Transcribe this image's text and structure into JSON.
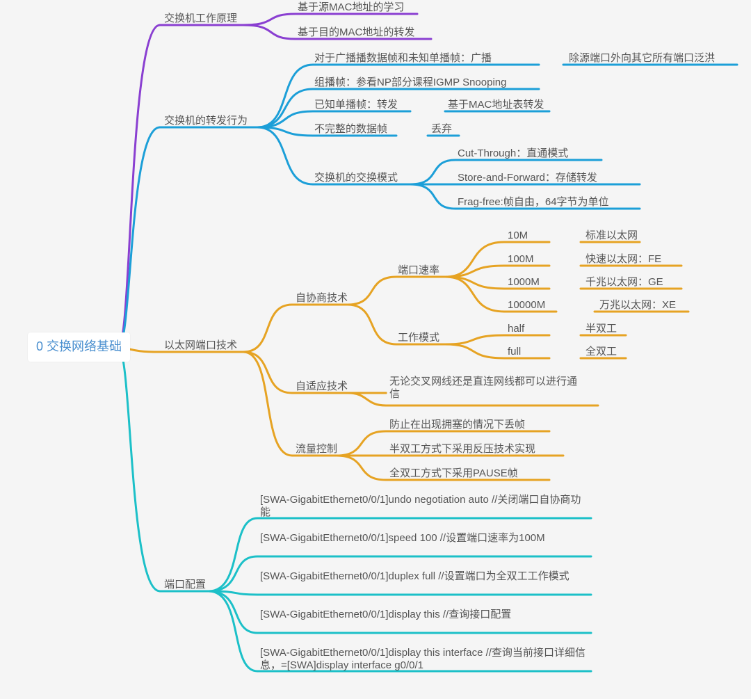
{
  "root": "0 交换网络基础",
  "b1": {
    "label": "交换机工作原理",
    "c1": "基于源MAC地址的学习",
    "c2": "基于目的MAC地址的转发"
  },
  "b2": {
    "label": "交换机的转发行为",
    "c1": "对于广播播数据帧和未知单播帧：广播",
    "c1a": "除源端口外向其它所有端口泛洪",
    "c2": "组播帧：参看NP部分课程IGMP Snooping",
    "c3": "已知单播帧：转发",
    "c3a": "基于MAC地址表转发",
    "c4": "不完整的数据帧",
    "c4a": "丢弃",
    "c5": {
      "label": "交换机的交换模式",
      "m1": "Cut-Through：直通模式",
      "m2": "Store-and-Forward：存储转发",
      "m3": "Frag-free:帧自由，64字节为单位"
    }
  },
  "b3": {
    "label": "以太网端口技术",
    "s1": {
      "label": "自协商技术",
      "r": {
        "label": "端口速率",
        "r1": "10M",
        "r1a": "标准以太网",
        "r2": "100M",
        "r2a": "快速以太网：FE",
        "r3": "1000M",
        "r3a": "千兆以太网：GE",
        "r4": "10000M",
        "r4a": "万兆以太网：XE"
      },
      "w": {
        "label": "工作模式",
        "w1": "half",
        "w1a": "半双工",
        "w2": "full",
        "w2a": "全双工"
      }
    },
    "s2": {
      "label": "自适应技术",
      "d": "无论交叉网线还是直连网线都可以进行通信"
    },
    "s3": {
      "label": "流量控制",
      "f1": "防止在出现拥塞的情况下丢帧",
      "f2": "半双工方式下采用反压技术实现",
      "f3": "全双工方式下采用PAUSE帧"
    }
  },
  "b4": {
    "label": "端口配置",
    "c1": "[SWA-GigabitEthernet0/0/1]undo negotiation auto   //关闭端口自协商功能",
    "c2": "[SWA-GigabitEthernet0/0/1]speed 100   //设置端口速率为100M",
    "c3": "[SWA-GigabitEthernet0/0/1]duplex full   //设置端口为全双工工作模式",
    "c4": "[SWA-GigabitEthernet0/0/1]display this   //查询接口配置",
    "c5": "[SWA-GigabitEthernet0/0/1]display this interface   //查询当前接口详细信息，=[SWA]display interface g0/0/1"
  },
  "colors": {
    "purple": "#8a3fd1",
    "blue": "#1c9fd8",
    "orange": "#e6a323",
    "teal": "#1cc0c8"
  }
}
